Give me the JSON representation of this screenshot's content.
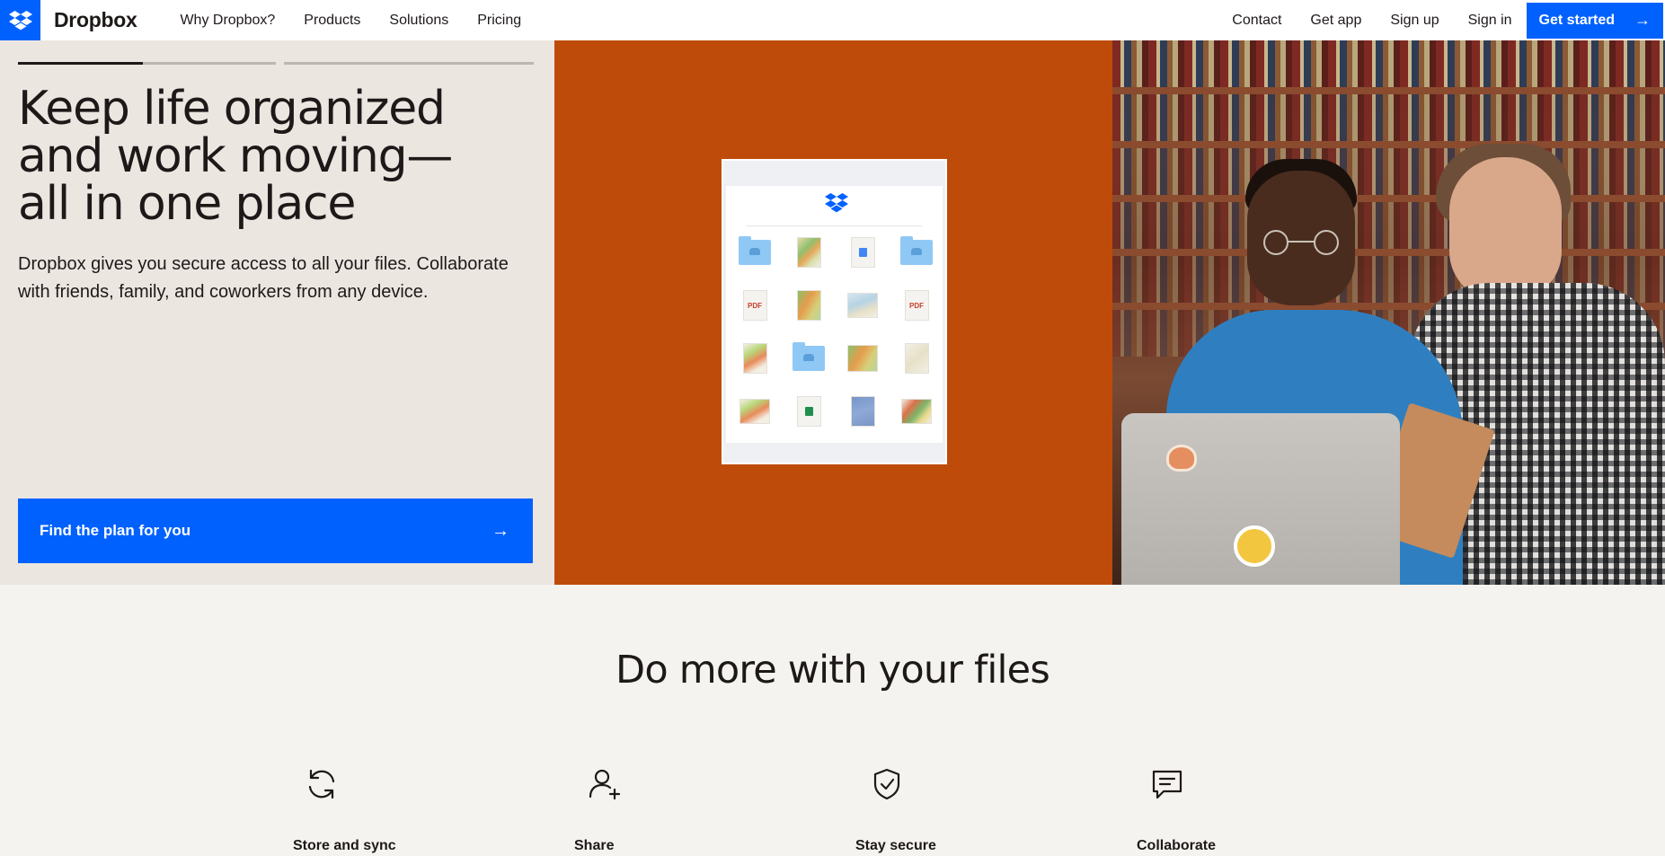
{
  "header": {
    "brand": "Dropbox",
    "nav_left": [
      "Why Dropbox?",
      "Products",
      "Solutions",
      "Pricing"
    ],
    "nav_right": [
      "Contact",
      "Get app",
      "Sign up",
      "Sign in"
    ],
    "cta": "Get started",
    "accent": "#0061fe"
  },
  "hero": {
    "title_lines": [
      "Keep life organized",
      "and work moving—",
      "all in one place"
    ],
    "subtitle": "Dropbox gives you secure access to all your files. Collaborate with friends, family, and coworkers from any device.",
    "plan_button": "Find the plan for you",
    "middle_bg": "#be4b0a",
    "left_bg": "#ece6e1",
    "mock_files": [
      "shared-folder-icon",
      "map-file-icon",
      "google-doc-icon",
      "shared-folder-icon",
      "pdf-file-icon",
      "map-file-icon",
      "map-file-icon",
      "pdf-file-icon",
      "map-file-icon",
      "shared-folder-icon",
      "map-file-icon",
      "document-file-icon",
      "map-file-icon",
      "excel-file-icon",
      "blueprint-file-icon",
      "map-file-icon"
    ],
    "pdf_label": "PDF"
  },
  "features": {
    "title": "Do more with your files",
    "items": [
      {
        "label": "Store and sync",
        "icon": "sync-icon"
      },
      {
        "label": "Share",
        "icon": "add-user-icon"
      },
      {
        "label": "Stay secure",
        "icon": "shield-check-icon"
      },
      {
        "label": "Collaborate",
        "icon": "chat-bubble-icon"
      }
    ]
  }
}
